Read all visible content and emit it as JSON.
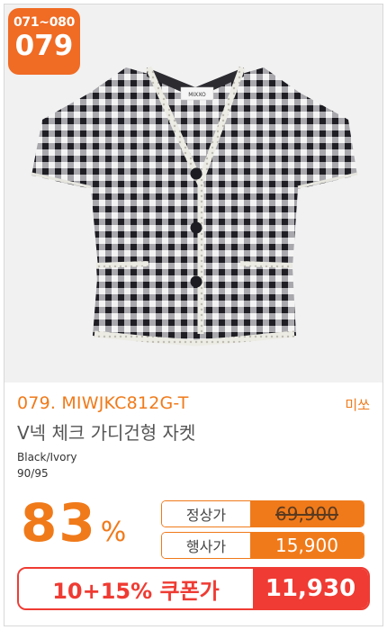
{
  "badge": {
    "range": "071~080",
    "number": "079"
  },
  "product": {
    "code_line": "079. MIWJKC812G-T",
    "brand": "미쏘",
    "title": "V넥 체크 가디건형 자켓",
    "color": "Black/Ivory",
    "size": "90/95",
    "image_label": "MIXXO"
  },
  "discount": {
    "percent": "83",
    "sign": "%"
  },
  "prices": {
    "normal_label": "정상가",
    "normal_value": "69,900",
    "event_label": "행사가",
    "event_value": "15,900",
    "coupon_label": "10+15% 쿠폰가",
    "coupon_value": "11,930"
  },
  "colors": {
    "accent": "#f07a1a",
    "coupon": "#ef3b33",
    "badge": "#f06b24"
  }
}
